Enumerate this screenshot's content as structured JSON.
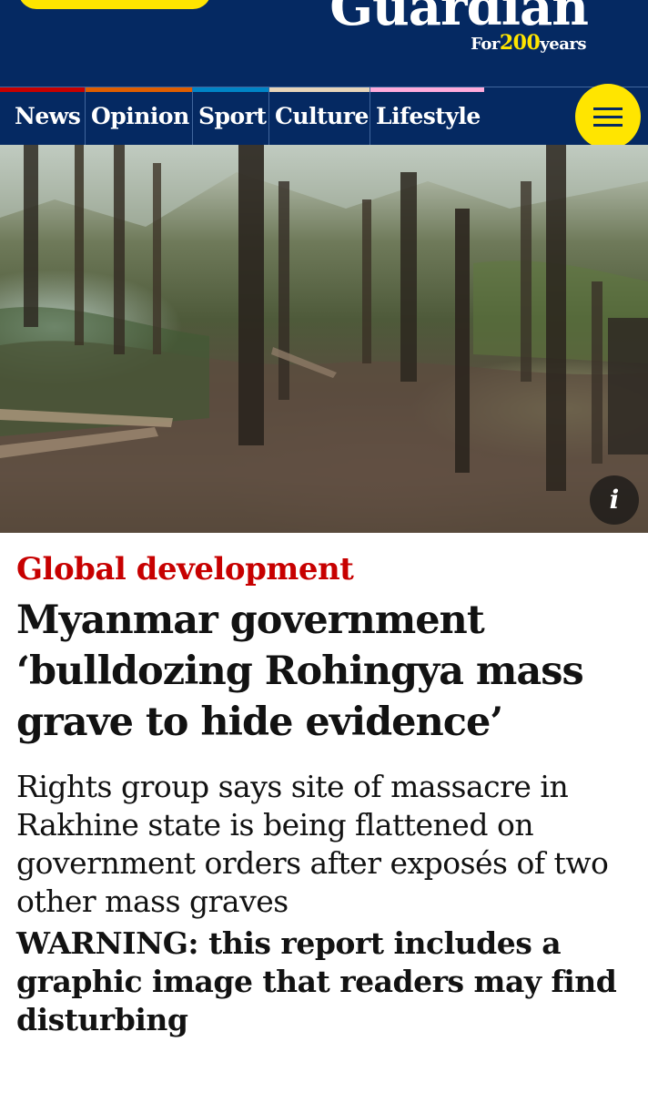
{
  "header": {
    "logo_word": "Guardian",
    "logo_tag_prefix": "For",
    "logo_tag_number": "200",
    "logo_tag_suffix": "years",
    "bg_color": "#052962",
    "accent_yellow": "#ffe500"
  },
  "nav": {
    "items": [
      {
        "label": "News",
        "color": "#c70000"
      },
      {
        "label": "Opinion",
        "color": "#e05e00"
      },
      {
        "label": "Sport",
        "color": "#0084c6"
      },
      {
        "label": "Culture",
        "color": "#e7d4b9"
      },
      {
        "label": "Lifestyle",
        "color": "#ffabdb"
      }
    ],
    "menu_icon": "hamburger-icon"
  },
  "hero": {
    "info_label": "i",
    "info_icon": "info-icon"
  },
  "article": {
    "kicker": "Global development",
    "kicker_color": "#c70000",
    "headline": "Myanmar government ‘bulldozing Rohingya mass grave to hide evidence’",
    "standfirst": "Rights group says site of massacre in Rakhine state is being flattened on government orders after exposés of two other mass graves",
    "warning": "WARNING: this report includes a graphic image that readers may find disturbing"
  }
}
